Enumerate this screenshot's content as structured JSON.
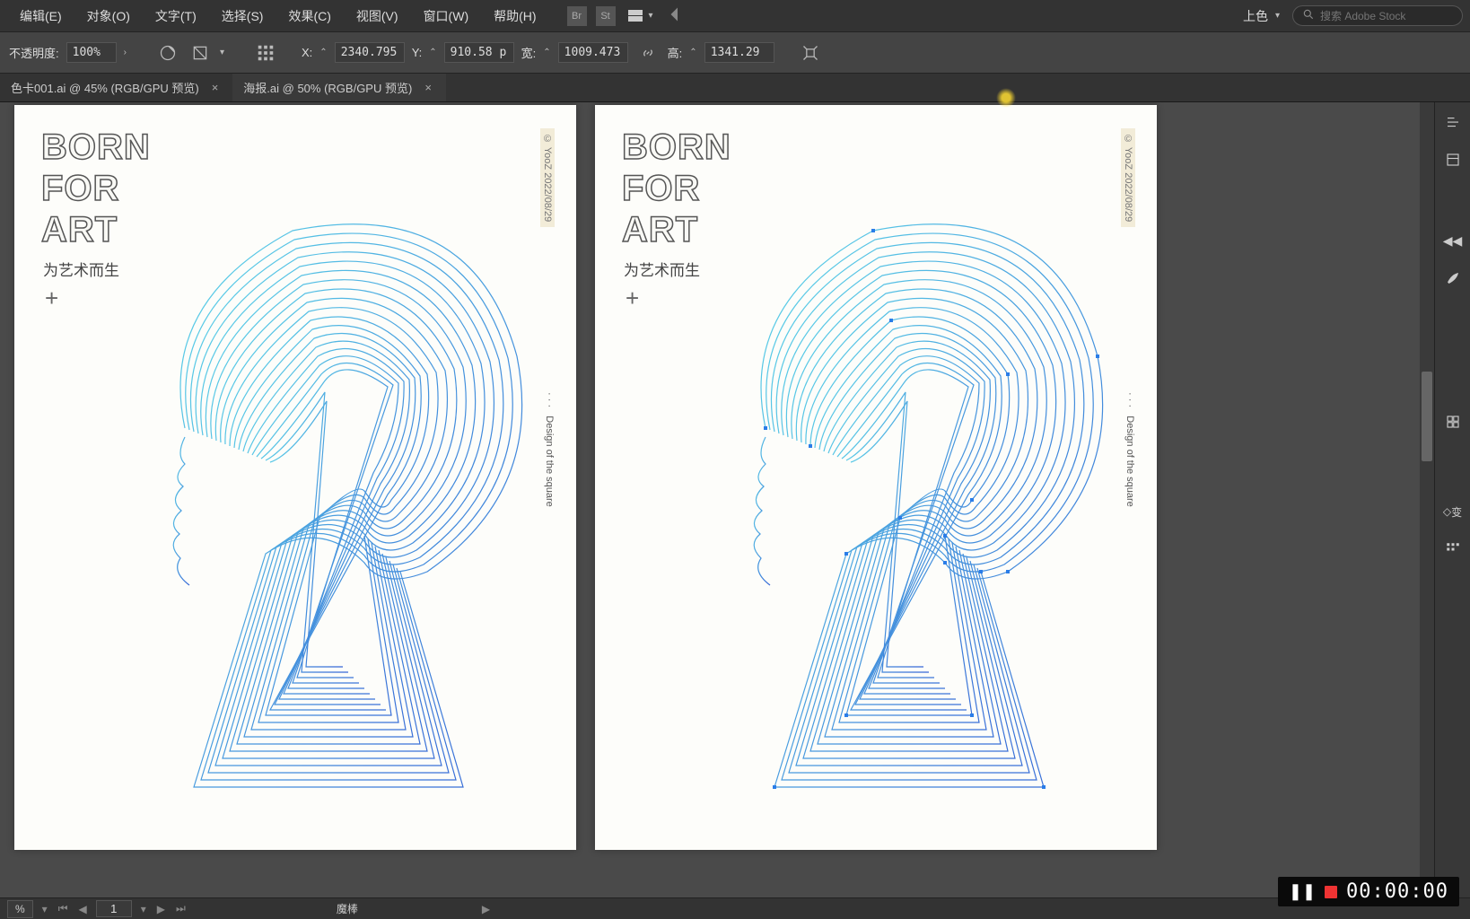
{
  "menubar": {
    "items": [
      "编辑(E)",
      "对象(O)",
      "文字(T)",
      "选择(S)",
      "效果(C)",
      "视图(V)",
      "窗口(W)",
      "帮助(H)"
    ],
    "icons": [
      "Br",
      "St"
    ],
    "workspace_label": "上色",
    "search_placeholder": "搜索 Adobe Stock"
  },
  "controlbar": {
    "opacity_label": "不透明度:",
    "opacity_value": "100%",
    "x_label": "X:",
    "x_value": "2340.795",
    "y_label": "Y:",
    "y_value": "910.58 p",
    "w_label": "宽:",
    "w_value": "1009.473",
    "h_label": "高:",
    "h_value": "1341.29"
  },
  "tabs": [
    {
      "label": "色卡001.ai @ 45% (RGB/GPU 预览)",
      "active": false
    },
    {
      "label": "海报.ai @ 50% (RGB/GPU 预览)",
      "active": true
    }
  ],
  "poster": {
    "title_line1": "BORN",
    "title_line2": "FOR",
    "title_line3": "ART",
    "subtitle": "为艺术而生",
    "plus": "+",
    "copyright": "© YooZ   2022/08/29",
    "design_dots": "· · ·",
    "design_text": "Design of the square"
  },
  "rightdock": {
    "transform_label": "变"
  },
  "statusbar": {
    "zoom": "%",
    "page": "1",
    "tool": "魔棒"
  },
  "timer": {
    "value": "00:00:00"
  }
}
